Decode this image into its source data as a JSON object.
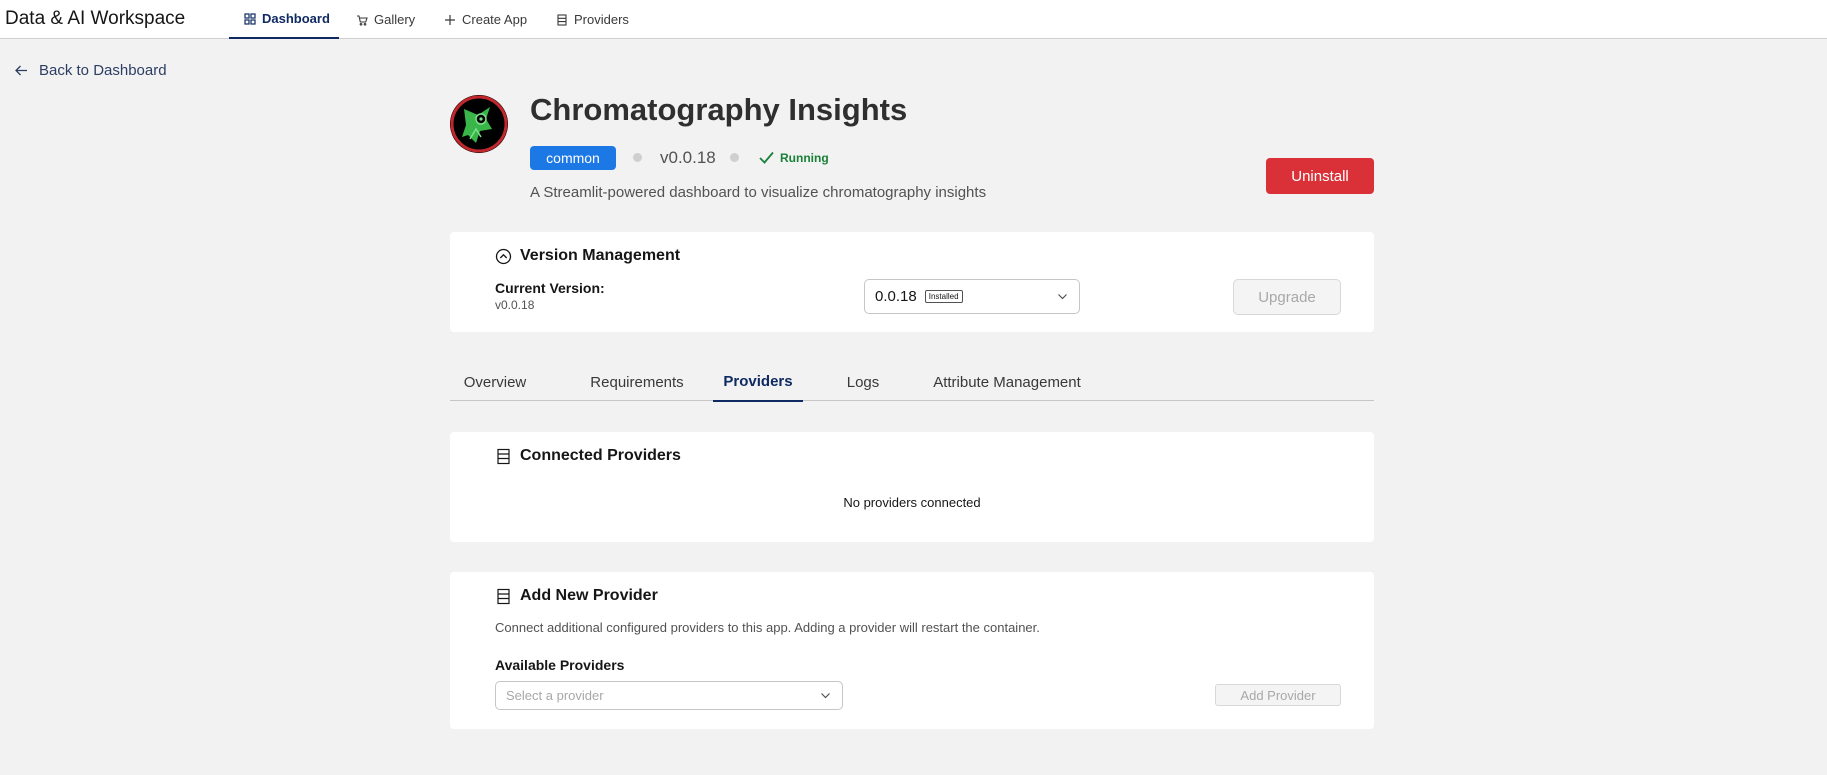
{
  "header": {
    "brand": "Data & AI Workspace",
    "nav": [
      {
        "label": "Dashboard",
        "icon": "dashboard-icon",
        "active": true
      },
      {
        "label": "Gallery",
        "icon": "cart-icon"
      },
      {
        "label": "Create App",
        "icon": "plus-icon"
      },
      {
        "label": "Providers",
        "icon": "server-icon"
      }
    ]
  },
  "back_link": "Back to Dashboard",
  "app": {
    "title": "Chromatography Insights",
    "tag": "common",
    "version": "v0.0.18",
    "status": "Running",
    "description": "A Streamlit-powered dashboard to visualize chromatography insights",
    "uninstall_label": "Uninstall"
  },
  "version_management": {
    "title": "Version Management",
    "current_version_label": "Current Version:",
    "current_version_value": "v0.0.18",
    "selected_version": "0.0.18",
    "installed_badge": "Installed",
    "upgrade_label": "Upgrade"
  },
  "tabs": [
    {
      "label": "Overview"
    },
    {
      "label": "Requirements"
    },
    {
      "label": "Providers",
      "active": true
    },
    {
      "label": "Logs"
    },
    {
      "label": "Attribute Management"
    }
  ],
  "connected_providers": {
    "title": "Connected Providers",
    "empty_message": "No providers connected"
  },
  "add_provider": {
    "title": "Add New Provider",
    "help_text": "Connect additional configured providers to this app. Adding a provider will restart the container.",
    "field_label": "Available Providers",
    "select_placeholder": "Select a provider",
    "button_label": "Add Provider"
  },
  "colors": {
    "accent": "#0f2a62",
    "tag": "#1c78e5",
    "danger": "#da3138",
    "success": "#198038",
    "page_bg": "#f2f2f2"
  }
}
